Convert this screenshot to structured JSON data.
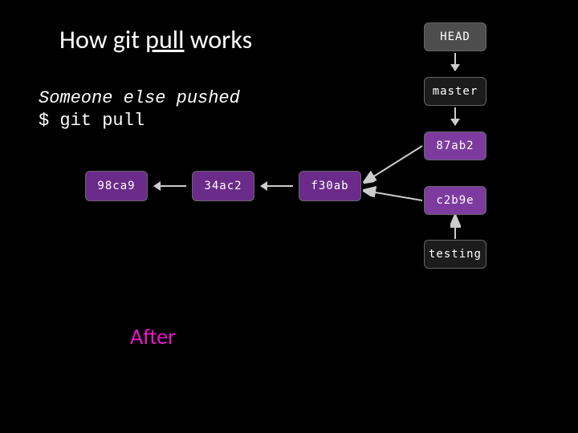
{
  "title": {
    "pre": "How git ",
    "underlined": "pull",
    "post": " works"
  },
  "desc_line": "Someone else pushed",
  "cmd_line": "$ git pull",
  "after_label": "After",
  "boxes": {
    "head": "HEAD",
    "master": "master",
    "c_87ab2": "87ab2",
    "c_c2b9e": "c2b9e",
    "testing": "testing",
    "c_98ca9": "98ca9",
    "c_34ac2": "34ac2",
    "c_f30ab": "f30ab"
  },
  "chart_data": {
    "type": "diagram",
    "title": "How git pull works",
    "annotations": [
      "Someone else pushed",
      "$ git pull",
      "After"
    ],
    "nodes": [
      {
        "id": "HEAD",
        "label": "HEAD",
        "kind": "ref"
      },
      {
        "id": "master",
        "label": "master",
        "kind": "branch"
      },
      {
        "id": "testing",
        "label": "testing",
        "kind": "branch"
      },
      {
        "id": "87ab2",
        "label": "87ab2",
        "kind": "commit"
      },
      {
        "id": "c2b9e",
        "label": "c2b9e",
        "kind": "commit"
      },
      {
        "id": "f30ab",
        "label": "f30ab",
        "kind": "commit"
      },
      {
        "id": "34ac2",
        "label": "34ac2",
        "kind": "commit"
      },
      {
        "id": "98ca9",
        "label": "98ca9",
        "kind": "commit"
      }
    ],
    "edges": [
      {
        "from": "HEAD",
        "to": "master"
      },
      {
        "from": "master",
        "to": "87ab2"
      },
      {
        "from": "87ab2",
        "to": "f30ab"
      },
      {
        "from": "c2b9e",
        "to": "f30ab"
      },
      {
        "from": "testing",
        "to": "c2b9e"
      },
      {
        "from": "f30ab",
        "to": "34ac2"
      },
      {
        "from": "34ac2",
        "to": "98ca9"
      }
    ]
  }
}
